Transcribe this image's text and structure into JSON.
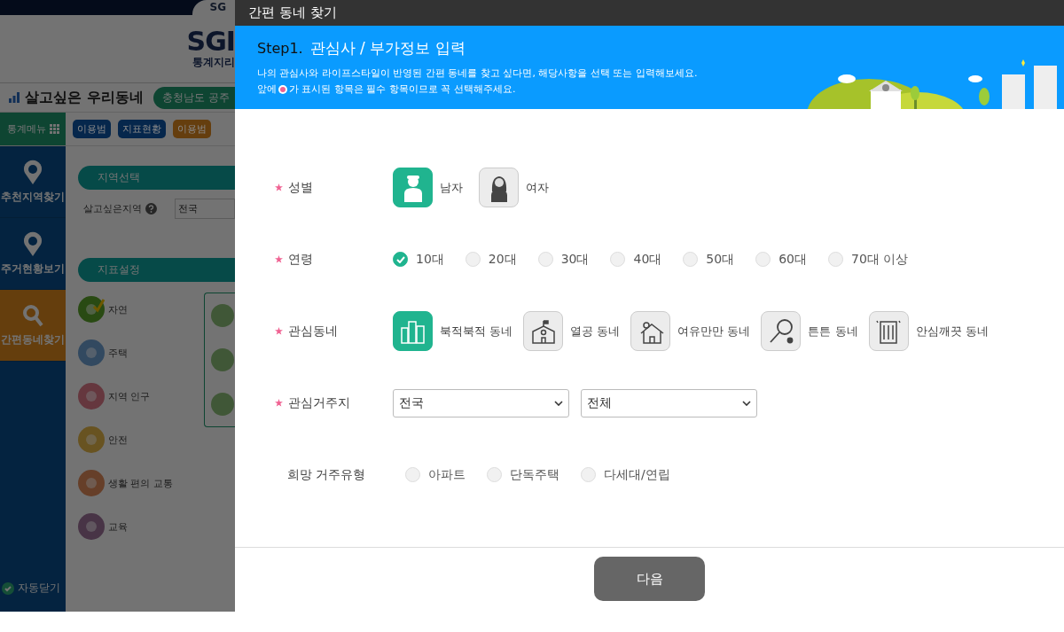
{
  "background": {
    "top_tab": "SG",
    "logo": "SGI",
    "logo_sub": "통계지리",
    "app_title": "살고싶은 우리동네",
    "region_badge": "충청남도 공주",
    "menu_button": "통계메뉴",
    "chips": [
      {
        "label": "이용범",
        "color": "#06274c"
      },
      {
        "label": "지표현황",
        "color": "#06274c"
      },
      {
        "label": "이용범",
        "color": "#653e0e"
      }
    ],
    "side_nav": [
      {
        "label": "추천지역찾기",
        "selected": false
      },
      {
        "label": "주거현황보기",
        "selected": false
      },
      {
        "label": "간편동네찾기",
        "selected": true
      }
    ],
    "region_section": "지역선택",
    "region_label": "살고싶은지역",
    "region_value": "전국",
    "indicator_section": "지표설정",
    "indicators": [
      {
        "label": "자연",
        "checked": true,
        "color": "#294a13"
      },
      {
        "label": "주택",
        "checked": false,
        "color": "#324960"
      },
      {
        "label": "지역 인구",
        "checked": false,
        "color": "#65373e"
      },
      {
        "label": "안전",
        "checked": false,
        "color": "#685321"
      },
      {
        "label": "생활 편의 교통",
        "checked": false,
        "color": "#663f29"
      },
      {
        "label": "교육",
        "checked": false,
        "color": "#483446"
      }
    ],
    "auto_close": {
      "label": "자동닫기",
      "checked": true
    }
  },
  "modal": {
    "title": "간편 동네 찾기",
    "step": "Step1.",
    "heading": "관심사 / 부가정보 입력",
    "description": "나의 관심사와 라이프스타일이 반영된 간편 동네를 찾고 싶다면, 해당사항을 선택 또는 입력해보세요.",
    "note_before": "앞에",
    "note_after": "가 표시된 항목은 필수 항목이므로 꼭 선택해주세요.",
    "rows": [
      {
        "kind": "icons",
        "label": "성별",
        "required": true,
        "options": [
          {
            "label": "남자",
            "selected": true
          },
          {
            "label": "여자",
            "selected": false
          }
        ]
      },
      {
        "kind": "radio",
        "label": "연령",
        "required": true,
        "options": [
          {
            "label": "10대",
            "selected": true
          },
          {
            "label": "20대",
            "selected": false
          },
          {
            "label": "30대",
            "selected": false
          },
          {
            "label": "40대",
            "selected": false
          },
          {
            "label": "50대",
            "selected": false
          },
          {
            "label": "60대",
            "selected": false
          },
          {
            "label": "70대 이상",
            "selected": false
          }
        ]
      },
      {
        "kind": "icons",
        "label": "관심동네",
        "required": true,
        "options": [
          {
            "label": "북적북적 동네",
            "selected": true
          },
          {
            "label": "열공 동네",
            "selected": false
          },
          {
            "label": "여유만만 동네",
            "selected": false
          },
          {
            "label": "튼튼 동네",
            "selected": false
          },
          {
            "label": "안심깨끗 동네",
            "selected": false
          }
        ]
      },
      {
        "kind": "selects",
        "label": "관심거주지",
        "required": true,
        "selects": [
          {
            "value": "전국"
          },
          {
            "value": "전체"
          }
        ]
      },
      {
        "kind": "radio",
        "label": "희망 거주유형",
        "required": false,
        "options": [
          {
            "label": "아파트",
            "selected": false
          },
          {
            "label": "단독주택",
            "selected": false
          },
          {
            "label": "다세대/연립",
            "selected": false
          }
        ]
      }
    ],
    "next_button": "다음"
  }
}
